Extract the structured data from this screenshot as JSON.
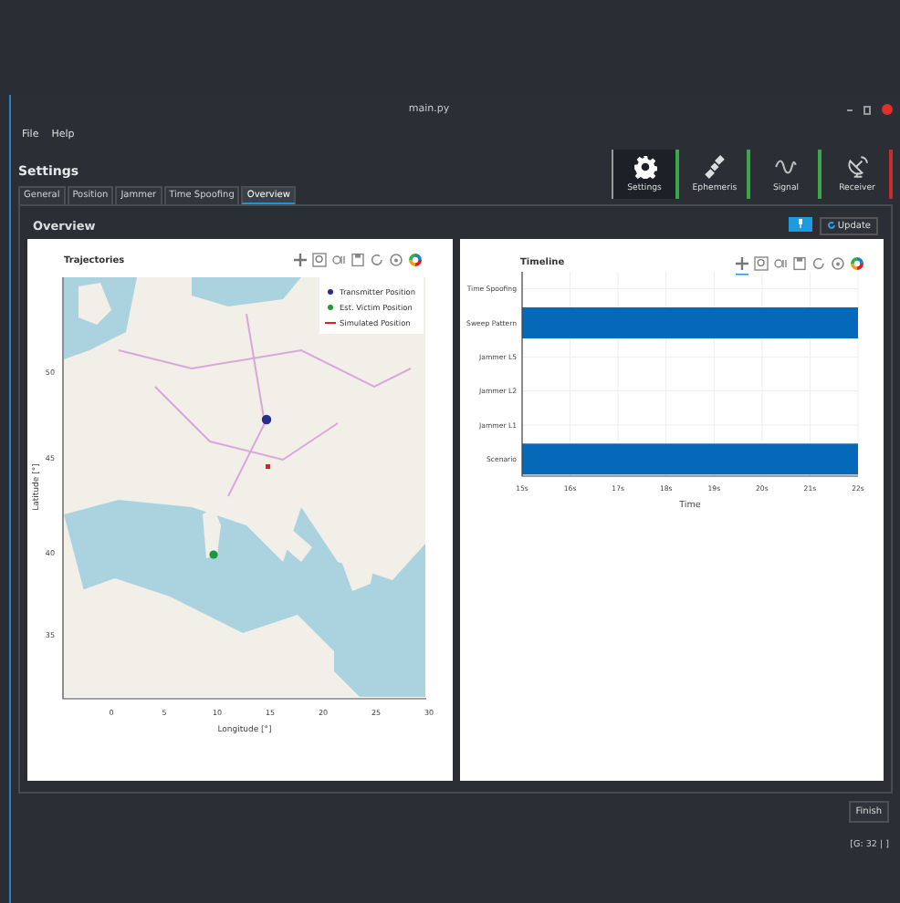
{
  "window": {
    "title": "main.py"
  },
  "menu": [
    "File",
    "Help"
  ],
  "heading": "Settings",
  "toolbar": [
    {
      "label": "Settings",
      "selected": true,
      "color": "#3aa84a"
    },
    {
      "label": "Ephemeris",
      "selected": false,
      "color": "#3aa84a"
    },
    {
      "label": "Signal",
      "selected": false,
      "color": "#3aa84a"
    },
    {
      "label": "Receiver",
      "selected": false,
      "color": "#c0302c"
    }
  ],
  "tabs": [
    {
      "label": "General",
      "selected": false
    },
    {
      "label": "Position",
      "selected": false
    },
    {
      "label": "Jammer",
      "selected": false
    },
    {
      "label": "Time Spoofing",
      "selected": false
    },
    {
      "label": "Overview",
      "selected": true
    }
  ],
  "panel_title": "Overview",
  "update_button": "Update",
  "trajectories": {
    "title": "Trajectories",
    "xlabel": "Longitude [°]",
    "ylabel": "Latitude [°]",
    "xticks": [
      "0",
      "5",
      "10",
      "15",
      "20",
      "25",
      "30"
    ],
    "yticks": [
      "50",
      "45",
      "40",
      "35"
    ],
    "legend": [
      {
        "label": "Transmitter Position",
        "kind": "dot",
        "color": "#2b2d8a"
      },
      {
        "label": "Est. Victim Position",
        "kind": "dot",
        "color": "#1a9a3a"
      },
      {
        "label": "Simulated Position",
        "kind": "line",
        "color": "#e0201c"
      }
    ]
  },
  "timeline": {
    "title": "Timeline",
    "chart_data": {
      "type": "bar",
      "orientation": "horizontal",
      "xlabel": "Time",
      "categories": [
        "Time Spoofing",
        "Sweep Pattern",
        "Jammer L5",
        "Jammer L2",
        "Jammer L1",
        "Scenario"
      ],
      "grid": true,
      "series": [
        {
          "color": "#0668b8",
          "values": [
            null,
            22,
            null,
            null,
            null,
            22
          ]
        }
      ],
      "xlim": [
        15,
        22
      ],
      "xticks": [
        {
          "value": 15,
          "label": "15s"
        },
        {
          "value": 16,
          "label": "16s"
        },
        {
          "value": 17,
          "label": "17s"
        },
        {
          "value": 18,
          "label": "18s"
        },
        {
          "value": 19,
          "label": "19s"
        },
        {
          "value": 20,
          "label": "20s"
        },
        {
          "value": 21,
          "label": "21s"
        },
        {
          "value": 22,
          "label": "22s"
        }
      ]
    }
  },
  "finish_button": "Finish",
  "status": "[G: 32 | ]"
}
